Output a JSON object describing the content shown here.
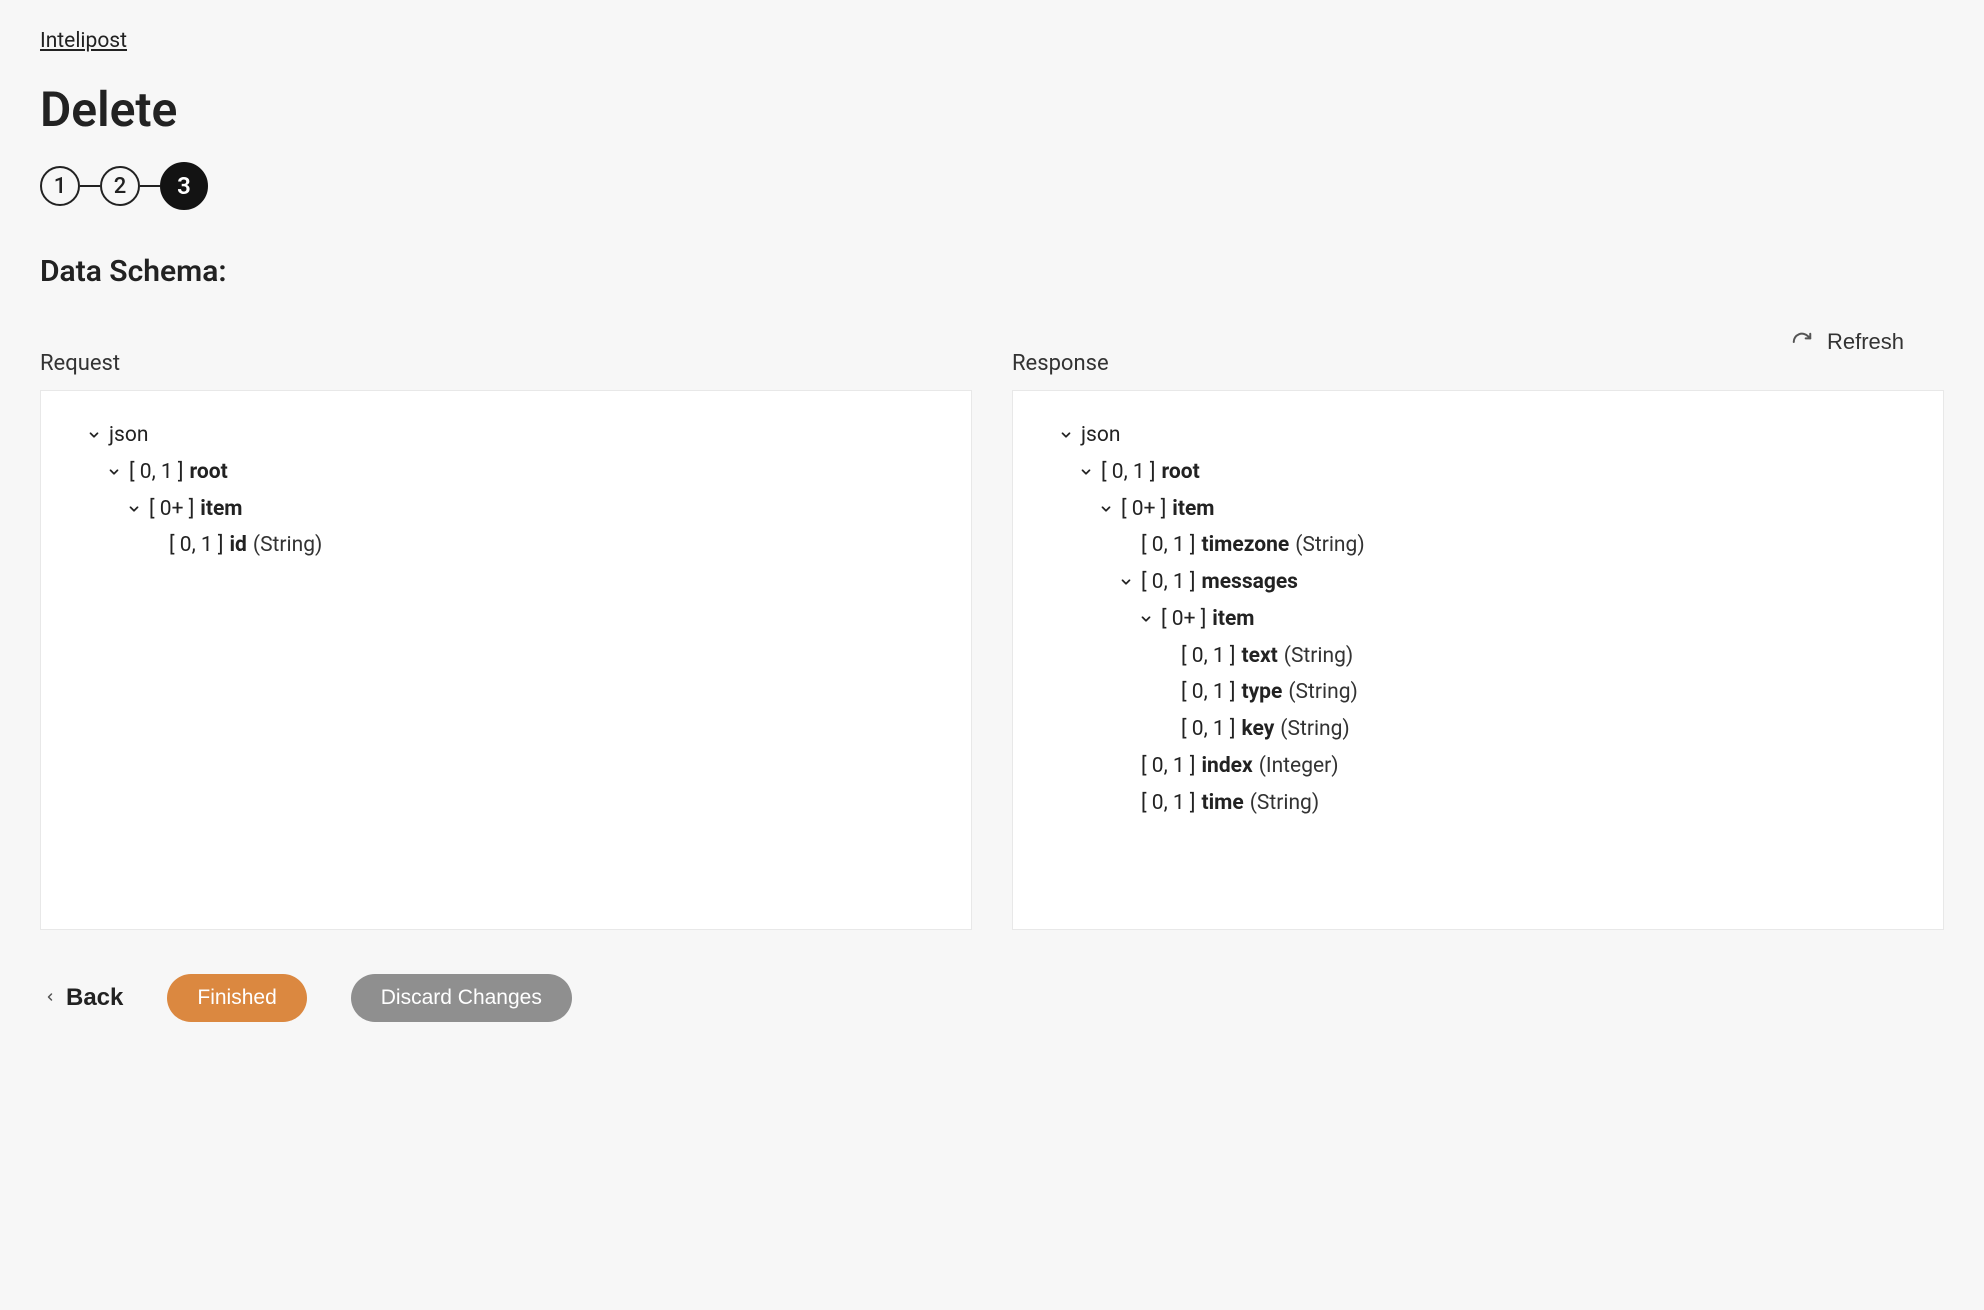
{
  "breadcrumb": "Intelipost",
  "title": "Delete",
  "stepper": {
    "steps": [
      "1",
      "2",
      "3"
    ],
    "active_index": 2
  },
  "section_heading": "Data Schema:",
  "refresh_label": "Refresh",
  "columns": {
    "request": {
      "label": "Request",
      "root_label": "json",
      "tree": [
        {
          "exp": true,
          "mult": "[ 0, 1 ]",
          "name": "root"
        },
        {
          "exp": true,
          "mult": "[ 0+ ]",
          "name": "item"
        },
        {
          "exp": false,
          "leaf": true,
          "mult": "[ 0, 1 ]",
          "name": "id",
          "type": "(String)"
        }
      ]
    },
    "response": {
      "label": "Response",
      "root_label": "json",
      "tree": [
        {
          "exp": true,
          "mult": "[ 0, 1 ]",
          "name": "root"
        },
        {
          "exp": true,
          "mult": "[ 0+ ]",
          "name": "item"
        },
        {
          "leaf": true,
          "mult": "[ 0, 1 ]",
          "name": "timezone",
          "type": "(String)"
        },
        {
          "exp": true,
          "mult": "[ 0, 1 ]",
          "name": "messages"
        },
        {
          "exp": true,
          "mult": "[ 0+ ]",
          "name": "item"
        },
        {
          "leaf": true,
          "mult": "[ 0, 1 ]",
          "name": "text",
          "type": "(String)"
        },
        {
          "leaf": true,
          "mult": "[ 0, 1 ]",
          "name": "type",
          "type": "(String)"
        },
        {
          "leaf": true,
          "mult": "[ 0, 1 ]",
          "name": "key",
          "type": "(String)"
        },
        {
          "leaf": true,
          "mult": "[ 0, 1 ]",
          "name": "index",
          "type": "(Integer)"
        },
        {
          "leaf": true,
          "mult": "[ 0, 1 ]",
          "name": "time",
          "type": "(String)"
        }
      ]
    }
  },
  "footer": {
    "back": "Back",
    "finished": "Finished",
    "discard": "Discard Changes"
  }
}
